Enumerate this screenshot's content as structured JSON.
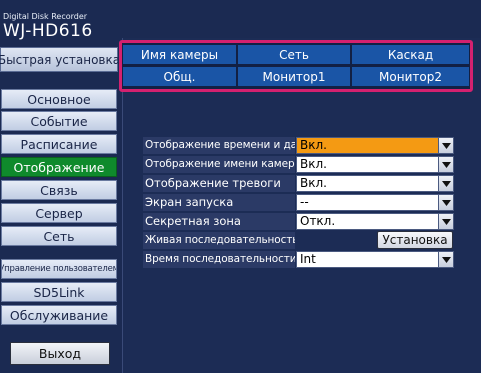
{
  "device": {
    "subtitle": "Digital Disk Recorder",
    "model": "WJ-HD616"
  },
  "sidebar": {
    "quick_setup": "Быстрая установка",
    "items": [
      {
        "label": "Основное"
      },
      {
        "label": "Событие"
      },
      {
        "label": "Расписание"
      },
      {
        "label": "Отображение"
      },
      {
        "label": "Связь"
      },
      {
        "label": "Сервер"
      },
      {
        "label": "Сеть"
      },
      {
        "label": "Управление пользователем"
      },
      {
        "label": "SD5Link"
      },
      {
        "label": "Обслуживание"
      }
    ],
    "active_index": 3,
    "exit_label": "Выход"
  },
  "tabs": {
    "row1": [
      "Имя камеры",
      "Сеть",
      "Каскад"
    ],
    "row2": [
      "Общ.",
      "Монитор1",
      "Монитор2"
    ],
    "highlight_color": "#d4216f"
  },
  "settings": {
    "rows": [
      {
        "label": "Отображение времени и даты",
        "value": "Вкл."
      },
      {
        "label": "Отображение имени камеры",
        "value": "Вкл."
      },
      {
        "label": "Отображение тревоги",
        "value": "Вкл."
      },
      {
        "label": "Экран запуска",
        "value": "--"
      },
      {
        "label": "Секретная зона",
        "value": "Откл."
      },
      {
        "label": "Живая последовательность",
        "button": "Установка"
      },
      {
        "label": "Время последовательности",
        "value": "Int"
      }
    ],
    "focused_row_color": "#f49a13"
  }
}
